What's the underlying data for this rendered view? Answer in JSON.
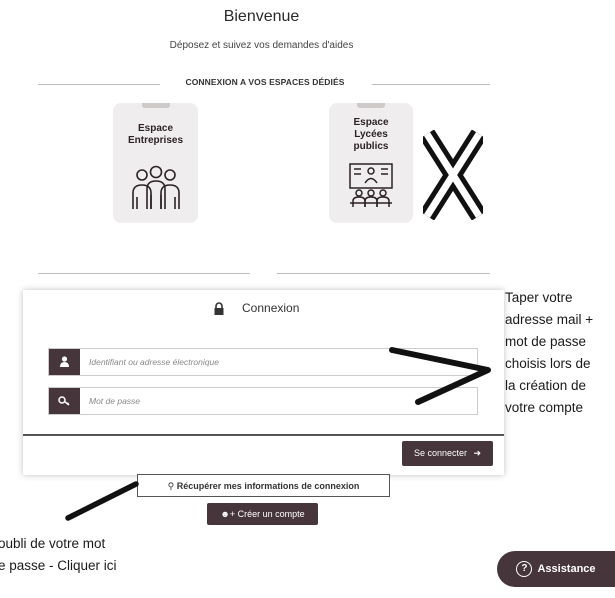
{
  "header": {
    "title": "Bienvenue",
    "subtitle": "Déposez et suivez vos demandes d'aides",
    "section_label": "CONNEXION A VOS ESPACES DÉDIÉS"
  },
  "spaces": [
    {
      "line1": "Espace",
      "line2": "Entreprises",
      "icon": "people-group-icon"
    },
    {
      "line1": "Espace",
      "line2": "Lycées",
      "line3": "publics",
      "icon": "classroom-icon"
    }
  ],
  "login": {
    "title": "Connexion",
    "username_placeholder": "Identifiant ou adresse électronique",
    "password_placeholder": "Mot de passe",
    "submit_label": "Se connecter",
    "recover_label": "Récupérer mes informations de connexion",
    "create_label": "Créer un compte"
  },
  "assistance": {
    "label": "Assistance"
  },
  "annotations": {
    "right": [
      "Taper votre",
      "adresse mail +",
      "mot de passe",
      "choisis lors de",
      "la création de",
      "votre compte"
    ],
    "bottom": [
      "oubli de votre mot",
      "e passe - Cliquer ici"
    ]
  },
  "colors": {
    "brand": "#46363b",
    "card": "#efeded",
    "text": "#333333"
  }
}
